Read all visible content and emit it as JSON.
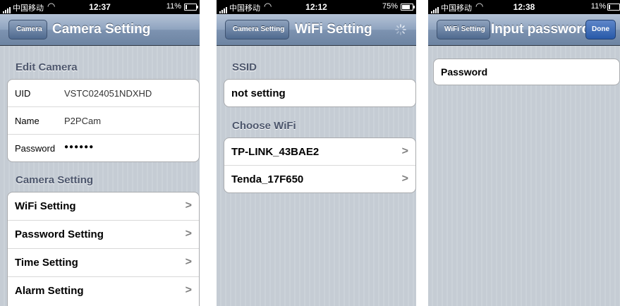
{
  "screens": [
    {
      "status": {
        "carrier": "中国移动",
        "time": "12:37",
        "battery": "11%",
        "battery_fill": 0.11
      },
      "nav": {
        "back_label": "Camera",
        "title": "Camera Setting"
      },
      "edit_section": {
        "header": "Edit Camera",
        "rows": [
          {
            "label": "UID",
            "value": "VSTC024051NDXHD"
          },
          {
            "label": "Name",
            "value": "P2PCam"
          },
          {
            "label": "Password",
            "value": "●●●●●●"
          }
        ]
      },
      "settings_section": {
        "header": "Camera Setting",
        "items": [
          "WiFi Setting",
          "Password Setting",
          "Time Setting",
          "Alarm Setting"
        ]
      }
    },
    {
      "status": {
        "carrier": "中国移动",
        "time": "12:12",
        "battery": "75%",
        "battery_fill": 0.75
      },
      "nav": {
        "back_label": "Camera Setting",
        "title": "WiFi Setting"
      },
      "ssid_section": {
        "header": "SSID",
        "value": "not setting"
      },
      "wifi_section": {
        "header": "Choose WiFi",
        "networks": [
          "TP-LINK_43BAE2",
          "Tenda_17F650"
        ]
      }
    },
    {
      "status": {
        "carrier": "中国移动",
        "time": "12:38",
        "battery": "11%",
        "battery_fill": 0.11
      },
      "nav": {
        "back_label": "WiFi Setting",
        "title": "Input password",
        "done_label": "Done"
      },
      "password_field": {
        "placeholder": "Password"
      }
    }
  ]
}
